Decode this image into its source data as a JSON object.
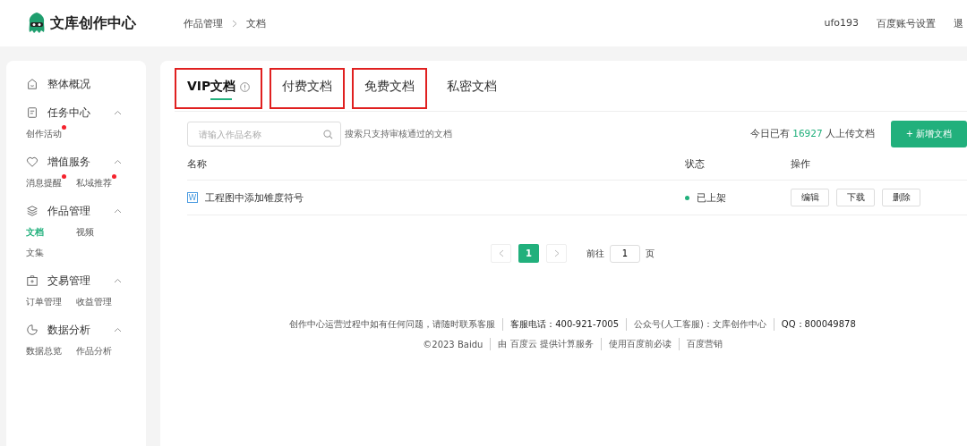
{
  "header": {
    "logo_text": "文库创作中心",
    "breadcrumb": [
      "作品管理",
      "文档"
    ],
    "user": "ufo193",
    "links": [
      "百度账号设置",
      "退"
    ]
  },
  "sidebar": {
    "groups": [
      {
        "label": "整体概况"
      },
      {
        "label": "任务中心",
        "expanded": true,
        "children": [
          {
            "label": "创作活动",
            "dot": true,
            "selected": false
          }
        ]
      },
      {
        "label": "增值服务",
        "expanded": true,
        "children": [
          {
            "label": "消息提醒",
            "dot": true,
            "selected": false
          },
          {
            "label": "私域推荐",
            "dot": true,
            "selected": false
          }
        ]
      },
      {
        "label": "作品管理",
        "expanded": true,
        "children": [
          {
            "label": "文档",
            "dot": false,
            "selected": true
          },
          {
            "label": "视频",
            "dot": false,
            "selected": false
          },
          {
            "label": "文集",
            "dot": false,
            "selected": false
          }
        ]
      },
      {
        "label": "交易管理",
        "expanded": true,
        "children": [
          {
            "label": "订单管理",
            "dot": false,
            "selected": false
          },
          {
            "label": "收益管理",
            "dot": false,
            "selected": false
          }
        ]
      },
      {
        "label": "数据分析",
        "expanded": true,
        "children": [
          {
            "label": "数据总览",
            "dot": false,
            "selected": false
          },
          {
            "label": "作品分析",
            "dot": false,
            "selected": false
          }
        ]
      }
    ]
  },
  "tabs": [
    {
      "label": "VIP文档",
      "selected": true,
      "info": true,
      "annotated": true
    },
    {
      "label": "付费文档",
      "selected": false,
      "info": false,
      "annotated": true
    },
    {
      "label": "免费文档",
      "selected": false,
      "info": false,
      "annotated": true
    },
    {
      "label": "私密文档",
      "selected": false,
      "info": false,
      "annotated": false
    }
  ],
  "search": {
    "placeholder": "请输入作品名称",
    "hint": "搜索只支持审核通过的文档"
  },
  "upload_stat": {
    "prefix": "今日已有",
    "count": "16927",
    "suffix": "人上传文档"
  },
  "add_button": "+ 新增文档",
  "table": {
    "columns": [
      "名称",
      "状态",
      "操作"
    ],
    "rows": [
      {
        "file_icon": "W",
        "name": "工程图中添加锥度符号",
        "status": "已上架",
        "actions": [
          "编辑",
          "下载",
          "删除"
        ]
      }
    ]
  },
  "pagination": {
    "pages": [
      {
        "label": "1",
        "selected": true
      }
    ],
    "goto_label": "前往",
    "goto_value": "1",
    "page_unit": "页"
  },
  "footer": {
    "line1": [
      {
        "text": "创作中心运营过程中如有任何问题，请随时联系客服",
        "emphasis": false
      },
      {
        "text": "客服电话：400-921-7005",
        "emphasis": true
      },
      {
        "text": "公众号(人工客服)：文库创作中心",
        "emphasis": false
      },
      {
        "text": "QQ：800049878",
        "emphasis": true
      }
    ],
    "line2": [
      "©2023 Baidu",
      "由 百度云 提供计算服务",
      "使用百度前必读",
      "百度营销"
    ]
  }
}
